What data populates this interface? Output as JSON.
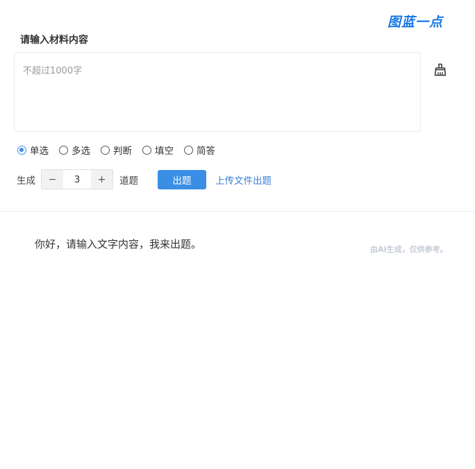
{
  "header": {
    "logo_text": "图蓝一点"
  },
  "material": {
    "title": "请输入材料内容",
    "placeholder": "不超过1000字",
    "value": ""
  },
  "clear_button": {
    "icon": "broom-icon"
  },
  "question_types": [
    {
      "label": "单选",
      "checked": true
    },
    {
      "label": "多选",
      "checked": false
    },
    {
      "label": "判断",
      "checked": false
    },
    {
      "label": "填空",
      "checked": false
    },
    {
      "label": "简答",
      "checked": false
    }
  ],
  "generate": {
    "label": "生成",
    "minus": "−",
    "count": "3",
    "plus": "+",
    "unit": "道题",
    "submit_label": "出题",
    "upload_label": "上传文件出题"
  },
  "result": {
    "greeting": "你好，请输入文字内容，我来出题。",
    "disclaimer": "由AI生成，仅供参考。"
  },
  "colors": {
    "accent": "#3a8ee6",
    "logo": "#1677e6",
    "link": "#3a7fd6",
    "disclaimer": "#c6ccd6"
  }
}
